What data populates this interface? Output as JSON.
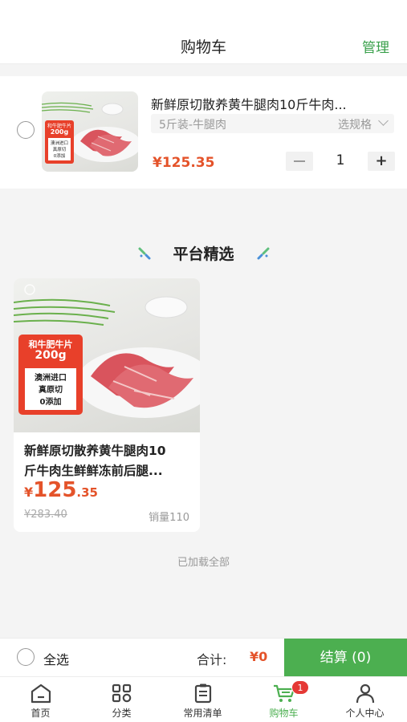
{
  "header": {
    "title": "购物车",
    "manage": "管理"
  },
  "cart_item": {
    "title": "新鲜原切散养黄牛腿肉10斤牛肉...",
    "spec": "5斤装-牛腿肉",
    "spec_select": "选规格",
    "price": "¥125.35",
    "quantity": "1",
    "minus_icon": "minus-icon",
    "plus_label": "+",
    "image_badge": {
      "top": "和牛肥牛片",
      "weight": "200g",
      "lines": [
        "澳洲进口",
        "真原切",
        "0添加"
      ]
    }
  },
  "recommend": {
    "section_title": "平台精选",
    "product": {
      "title_line1": "新鲜原切散养黄牛腿肉10",
      "title_line2": "斤牛肉生鲜鲜冻前后腿...",
      "currency": "¥",
      "price_int": "125",
      "price_dec": ".35",
      "original_price": "¥283.40",
      "sales": "销量110",
      "image_badge": {
        "top": "和牛肥牛片",
        "weight": "200g",
        "lines": [
          "澳洲进口",
          "真原切",
          "0添加"
        ]
      }
    },
    "loaded_all": "已加载全部"
  },
  "checkout": {
    "select_all": "全选",
    "total_label": "合计:",
    "total_value": "¥0",
    "settle_button": "结算 (0)"
  },
  "tabbar": {
    "items": [
      {
        "label": "首页",
        "icon": "home-icon"
      },
      {
        "label": "分类",
        "icon": "category-grid-icon"
      },
      {
        "label": "常用清单",
        "icon": "clipboard-list-icon"
      },
      {
        "label": "购物车",
        "icon": "cart-icon",
        "badge": "1",
        "active": true
      },
      {
        "label": "个人中心",
        "icon": "user-icon"
      }
    ]
  },
  "colors": {
    "accent_green": "#4caf50",
    "price_orange": "#e4532a",
    "badge_red": "#e53935"
  }
}
